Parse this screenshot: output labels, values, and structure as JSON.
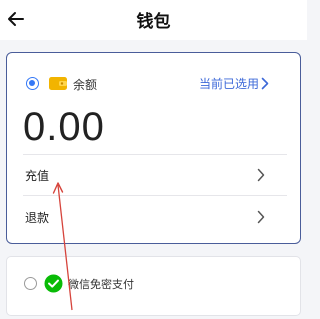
{
  "header": {
    "title": "钱包",
    "back_icon": "back-arrow-icon"
  },
  "balance_card": {
    "selected": true,
    "icon": "wallet-icon",
    "label": "余额",
    "selected_status": "当前已选用",
    "amount": "0.00",
    "accent_color": "#3478f6",
    "border_color": "#4a5d9a"
  },
  "actions": [
    {
      "label": "充值",
      "icon": "chevron-right-icon"
    },
    {
      "label": "退款",
      "icon": "chevron-right-icon"
    }
  ],
  "payment_options": [
    {
      "label": "微信免密支付",
      "icon": "wechat-pay-icon",
      "selected": false,
      "brand_color": "#09bb07"
    }
  ],
  "annotation": {
    "arrow_color": "#d6443c"
  }
}
